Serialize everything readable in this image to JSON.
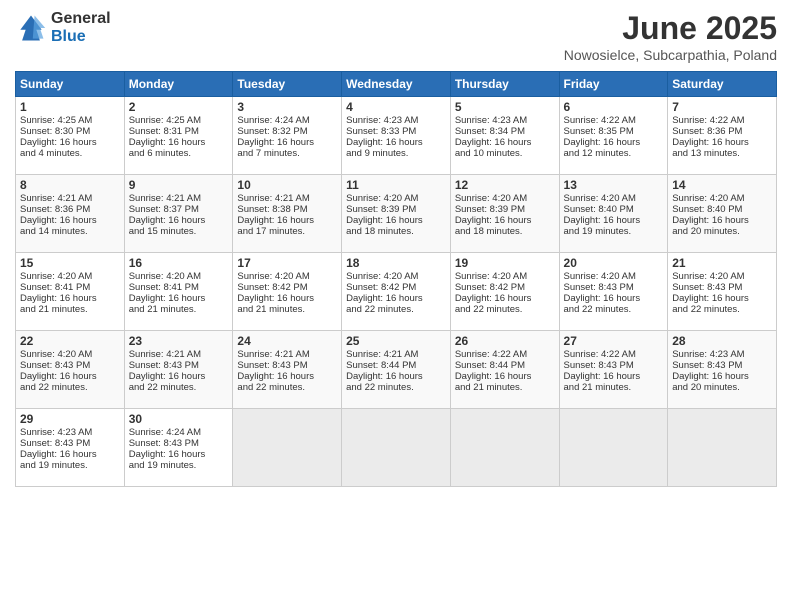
{
  "logo": {
    "general": "General",
    "blue": "Blue"
  },
  "title": "June 2025",
  "subtitle": "Nowosielce, Subcarpathia, Poland",
  "days_header": [
    "Sunday",
    "Monday",
    "Tuesday",
    "Wednesday",
    "Thursday",
    "Friday",
    "Saturday"
  ],
  "weeks": [
    [
      {
        "num": "1",
        "lines": [
          "Sunrise: 4:25 AM",
          "Sunset: 8:30 PM",
          "Daylight: 16 hours",
          "and 4 minutes."
        ]
      },
      {
        "num": "2",
        "lines": [
          "Sunrise: 4:25 AM",
          "Sunset: 8:31 PM",
          "Daylight: 16 hours",
          "and 6 minutes."
        ]
      },
      {
        "num": "3",
        "lines": [
          "Sunrise: 4:24 AM",
          "Sunset: 8:32 PM",
          "Daylight: 16 hours",
          "and 7 minutes."
        ]
      },
      {
        "num": "4",
        "lines": [
          "Sunrise: 4:23 AM",
          "Sunset: 8:33 PM",
          "Daylight: 16 hours",
          "and 9 minutes."
        ]
      },
      {
        "num": "5",
        "lines": [
          "Sunrise: 4:23 AM",
          "Sunset: 8:34 PM",
          "Daylight: 16 hours",
          "and 10 minutes."
        ]
      },
      {
        "num": "6",
        "lines": [
          "Sunrise: 4:22 AM",
          "Sunset: 8:35 PM",
          "Daylight: 16 hours",
          "and 12 minutes."
        ]
      },
      {
        "num": "7",
        "lines": [
          "Sunrise: 4:22 AM",
          "Sunset: 8:36 PM",
          "Daylight: 16 hours",
          "and 13 minutes."
        ]
      }
    ],
    [
      {
        "num": "8",
        "lines": [
          "Sunrise: 4:21 AM",
          "Sunset: 8:36 PM",
          "Daylight: 16 hours",
          "and 14 minutes."
        ]
      },
      {
        "num": "9",
        "lines": [
          "Sunrise: 4:21 AM",
          "Sunset: 8:37 PM",
          "Daylight: 16 hours",
          "and 15 minutes."
        ]
      },
      {
        "num": "10",
        "lines": [
          "Sunrise: 4:21 AM",
          "Sunset: 8:38 PM",
          "Daylight: 16 hours",
          "and 17 minutes."
        ]
      },
      {
        "num": "11",
        "lines": [
          "Sunrise: 4:20 AM",
          "Sunset: 8:39 PM",
          "Daylight: 16 hours",
          "and 18 minutes."
        ]
      },
      {
        "num": "12",
        "lines": [
          "Sunrise: 4:20 AM",
          "Sunset: 8:39 PM",
          "Daylight: 16 hours",
          "and 18 minutes."
        ]
      },
      {
        "num": "13",
        "lines": [
          "Sunrise: 4:20 AM",
          "Sunset: 8:40 PM",
          "Daylight: 16 hours",
          "and 19 minutes."
        ]
      },
      {
        "num": "14",
        "lines": [
          "Sunrise: 4:20 AM",
          "Sunset: 8:40 PM",
          "Daylight: 16 hours",
          "and 20 minutes."
        ]
      }
    ],
    [
      {
        "num": "15",
        "lines": [
          "Sunrise: 4:20 AM",
          "Sunset: 8:41 PM",
          "Daylight: 16 hours",
          "and 21 minutes."
        ]
      },
      {
        "num": "16",
        "lines": [
          "Sunrise: 4:20 AM",
          "Sunset: 8:41 PM",
          "Daylight: 16 hours",
          "and 21 minutes."
        ]
      },
      {
        "num": "17",
        "lines": [
          "Sunrise: 4:20 AM",
          "Sunset: 8:42 PM",
          "Daylight: 16 hours",
          "and 21 minutes."
        ]
      },
      {
        "num": "18",
        "lines": [
          "Sunrise: 4:20 AM",
          "Sunset: 8:42 PM",
          "Daylight: 16 hours",
          "and 22 minutes."
        ]
      },
      {
        "num": "19",
        "lines": [
          "Sunrise: 4:20 AM",
          "Sunset: 8:42 PM",
          "Daylight: 16 hours",
          "and 22 minutes."
        ]
      },
      {
        "num": "20",
        "lines": [
          "Sunrise: 4:20 AM",
          "Sunset: 8:43 PM",
          "Daylight: 16 hours",
          "and 22 minutes."
        ]
      },
      {
        "num": "21",
        "lines": [
          "Sunrise: 4:20 AM",
          "Sunset: 8:43 PM",
          "Daylight: 16 hours",
          "and 22 minutes."
        ]
      }
    ],
    [
      {
        "num": "22",
        "lines": [
          "Sunrise: 4:20 AM",
          "Sunset: 8:43 PM",
          "Daylight: 16 hours",
          "and 22 minutes."
        ]
      },
      {
        "num": "23",
        "lines": [
          "Sunrise: 4:21 AM",
          "Sunset: 8:43 PM",
          "Daylight: 16 hours",
          "and 22 minutes."
        ]
      },
      {
        "num": "24",
        "lines": [
          "Sunrise: 4:21 AM",
          "Sunset: 8:43 PM",
          "Daylight: 16 hours",
          "and 22 minutes."
        ]
      },
      {
        "num": "25",
        "lines": [
          "Sunrise: 4:21 AM",
          "Sunset: 8:44 PM",
          "Daylight: 16 hours",
          "and 22 minutes."
        ]
      },
      {
        "num": "26",
        "lines": [
          "Sunrise: 4:22 AM",
          "Sunset: 8:44 PM",
          "Daylight: 16 hours",
          "and 21 minutes."
        ]
      },
      {
        "num": "27",
        "lines": [
          "Sunrise: 4:22 AM",
          "Sunset: 8:43 PM",
          "Daylight: 16 hours",
          "and 21 minutes."
        ]
      },
      {
        "num": "28",
        "lines": [
          "Sunrise: 4:23 AM",
          "Sunset: 8:43 PM",
          "Daylight: 16 hours",
          "and 20 minutes."
        ]
      }
    ],
    [
      {
        "num": "29",
        "lines": [
          "Sunrise: 4:23 AM",
          "Sunset: 8:43 PM",
          "Daylight: 16 hours",
          "and 19 minutes."
        ]
      },
      {
        "num": "30",
        "lines": [
          "Sunrise: 4:24 AM",
          "Sunset: 8:43 PM",
          "Daylight: 16 hours",
          "and 19 minutes."
        ]
      },
      {
        "num": "",
        "lines": []
      },
      {
        "num": "",
        "lines": []
      },
      {
        "num": "",
        "lines": []
      },
      {
        "num": "",
        "lines": []
      },
      {
        "num": "",
        "lines": []
      }
    ]
  ]
}
